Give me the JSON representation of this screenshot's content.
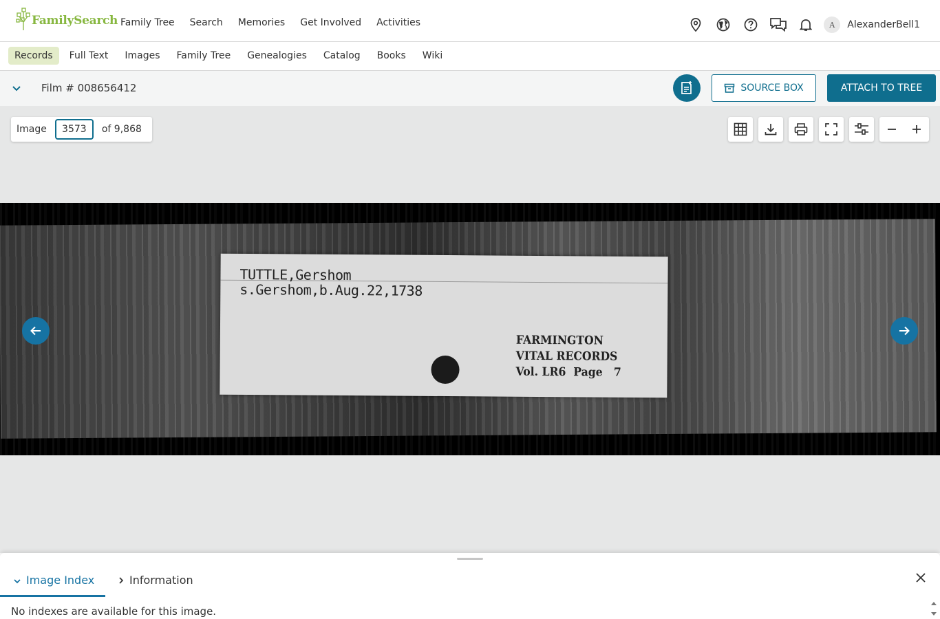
{
  "header": {
    "logo_text": "FamilySearch",
    "nav": [
      "Family Tree",
      "Search",
      "Memories",
      "Get Involved",
      "Activities"
    ],
    "avatar_initial": "A",
    "username": "AlexanderBell1"
  },
  "subnav": {
    "items": [
      "Records",
      "Full Text",
      "Images",
      "Family Tree",
      "Genealogies",
      "Catalog",
      "Books",
      "Wiki"
    ],
    "active": "Records"
  },
  "filmbar": {
    "title": "Film # 008656412",
    "source_box_label": "SOURCE BOX",
    "attach_label": "ATTACH TO TREE"
  },
  "viewer": {
    "image_label": "Image",
    "image_number": "3573",
    "image_total": "of 9,868",
    "record_card": {
      "name_line": "TUTTLE,Gershom",
      "birth_line": "s.Gershom,b.Aug.22,1738",
      "source_lines": [
        "FARMINGTON",
        "VITAL RECORDS",
        "Vol. LR6  Page   7"
      ]
    }
  },
  "panel": {
    "tabs": [
      "Image Index",
      "Information"
    ],
    "active_tab": "Image Index",
    "message": "No indexes are available for this image."
  },
  "colors": {
    "brand_green": "#87b740",
    "accent_teal": "#0f6e8e",
    "active_subnav_bg": "#e3ecc9",
    "link_blue": "#1673a3"
  }
}
